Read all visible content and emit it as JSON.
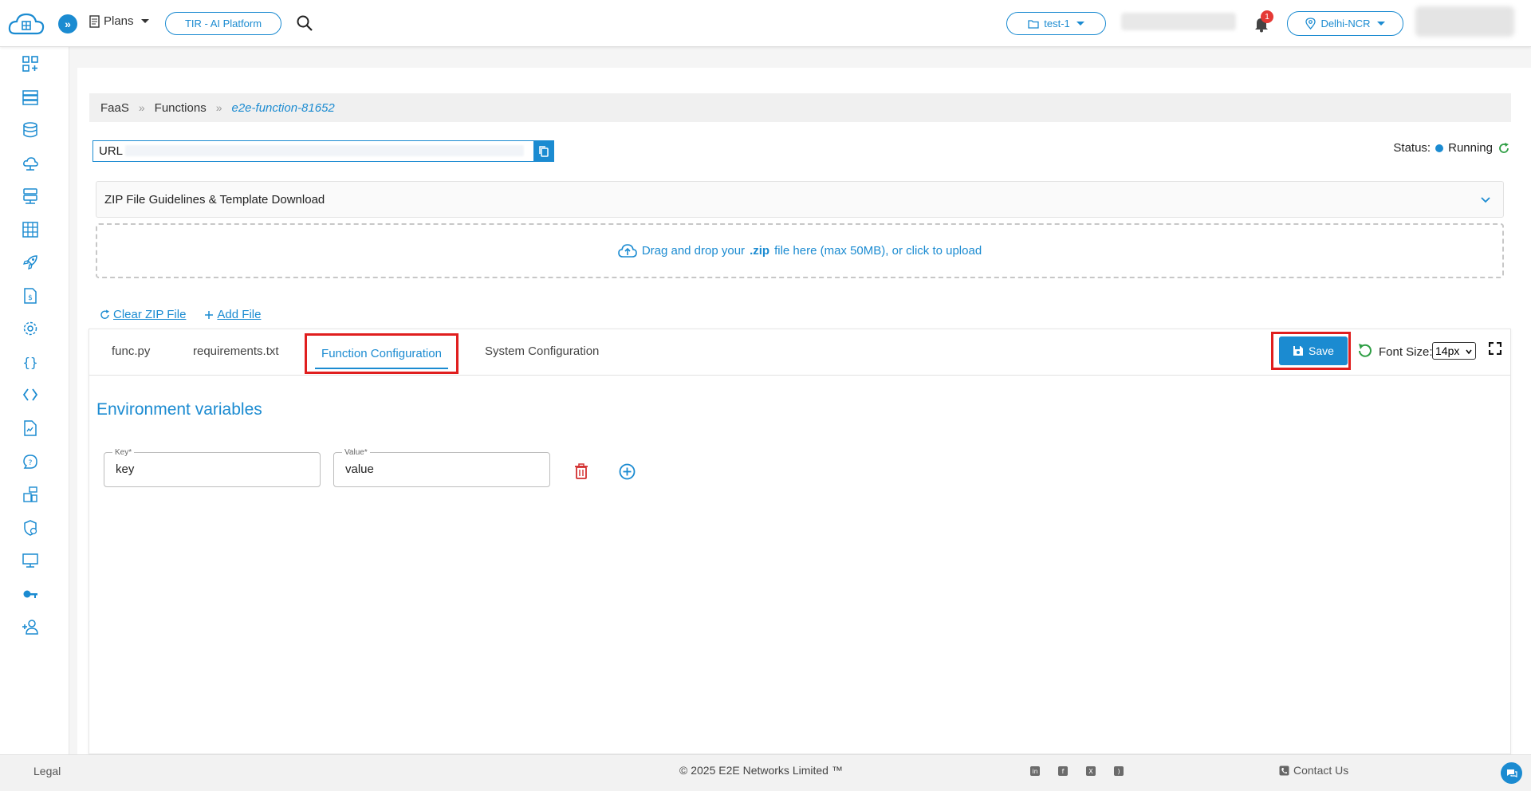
{
  "header": {
    "plans_label": "Plans",
    "platform_label": "TIR - AI Platform",
    "project_label": "test-1",
    "notification_count": "1",
    "region_label": "Delhi-NCR"
  },
  "breadcrumb": {
    "items": [
      "FaaS",
      "Functions"
    ],
    "current": "e2e-function-81652",
    "separator": "»"
  },
  "url_field": {
    "label": "URL"
  },
  "status": {
    "label": "Status:",
    "value": "Running"
  },
  "accordion": {
    "title": "ZIP File Guidelines & Template Download"
  },
  "dropzone": {
    "text_before": "Drag and drop your",
    "bold": ".zip",
    "text_after": "file here (max 50MB), or click to upload"
  },
  "zip_actions": {
    "clear": "Clear ZIP File",
    "add": "Add File"
  },
  "tabs": [
    {
      "label": "func.py"
    },
    {
      "label": "requirements.txt"
    },
    {
      "label": "Function Configuration",
      "active": true
    },
    {
      "label": "System Configuration"
    }
  ],
  "toolbar": {
    "save_label": "Save",
    "font_size_label": "Font Size:",
    "font_size_value": "14px"
  },
  "env": {
    "title": "Environment variables",
    "key_label": "Key*",
    "key_value": "key",
    "value_label": "Value*",
    "value_value": "value"
  },
  "footer": {
    "legal": "Legal",
    "copyright": "© 2025 E2E Networks Limited ™",
    "contact": "Contact Us",
    "social_icons": [
      "linkedin-icon",
      "facebook-icon",
      "x-icon",
      "rss-icon"
    ]
  },
  "colors": {
    "accent": "#1b8bd1",
    "highlight": "#e01e1e",
    "status_running": "#1b8bd1",
    "danger": "#d32f2f"
  }
}
